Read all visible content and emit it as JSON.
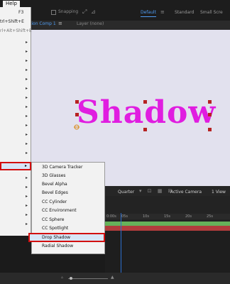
{
  "app_bar": {
    "menu_help": "Help",
    "snapping_label": "Snapping",
    "workspaces": [
      "Default",
      "Standard",
      "Small Scre"
    ]
  },
  "tabs": {
    "composition_tab": "tion Comp 1",
    "composition_menu": "≡",
    "layer_tab": "Layer (none)"
  },
  "viewer": {
    "text": "Shadow"
  },
  "viewer_toolbar": {
    "resolution": "Quarter",
    "camera": "Active Camera",
    "views": "1 View"
  },
  "timeline": {
    "ticks": [
      "0:00s",
      "05s",
      "10s",
      "15s",
      "20s",
      "25s"
    ]
  },
  "menu": {
    "items": [
      {
        "label": "",
        "key": "F3"
      },
      {
        "label": "",
        "key": "trl+Shift+E"
      },
      {
        "label": "",
        "key": "rl+Alt+Shift+E"
      }
    ]
  },
  "submenu": {
    "items": [
      "3D Camera Tracker",
      "3D Glasses",
      "Bevel Alpha",
      "Bevel Edges",
      "CC Cylinder",
      "CC Environment",
      "CC Sphere",
      "CC Spotlight",
      "Drop Shadow",
      "Radial Shadow"
    ],
    "selected": "Drop Shadow"
  },
  "colors": {
    "text_fill": "#e01de0",
    "accent": "#4f9cf2",
    "highlight_border": "#d20f0f"
  }
}
